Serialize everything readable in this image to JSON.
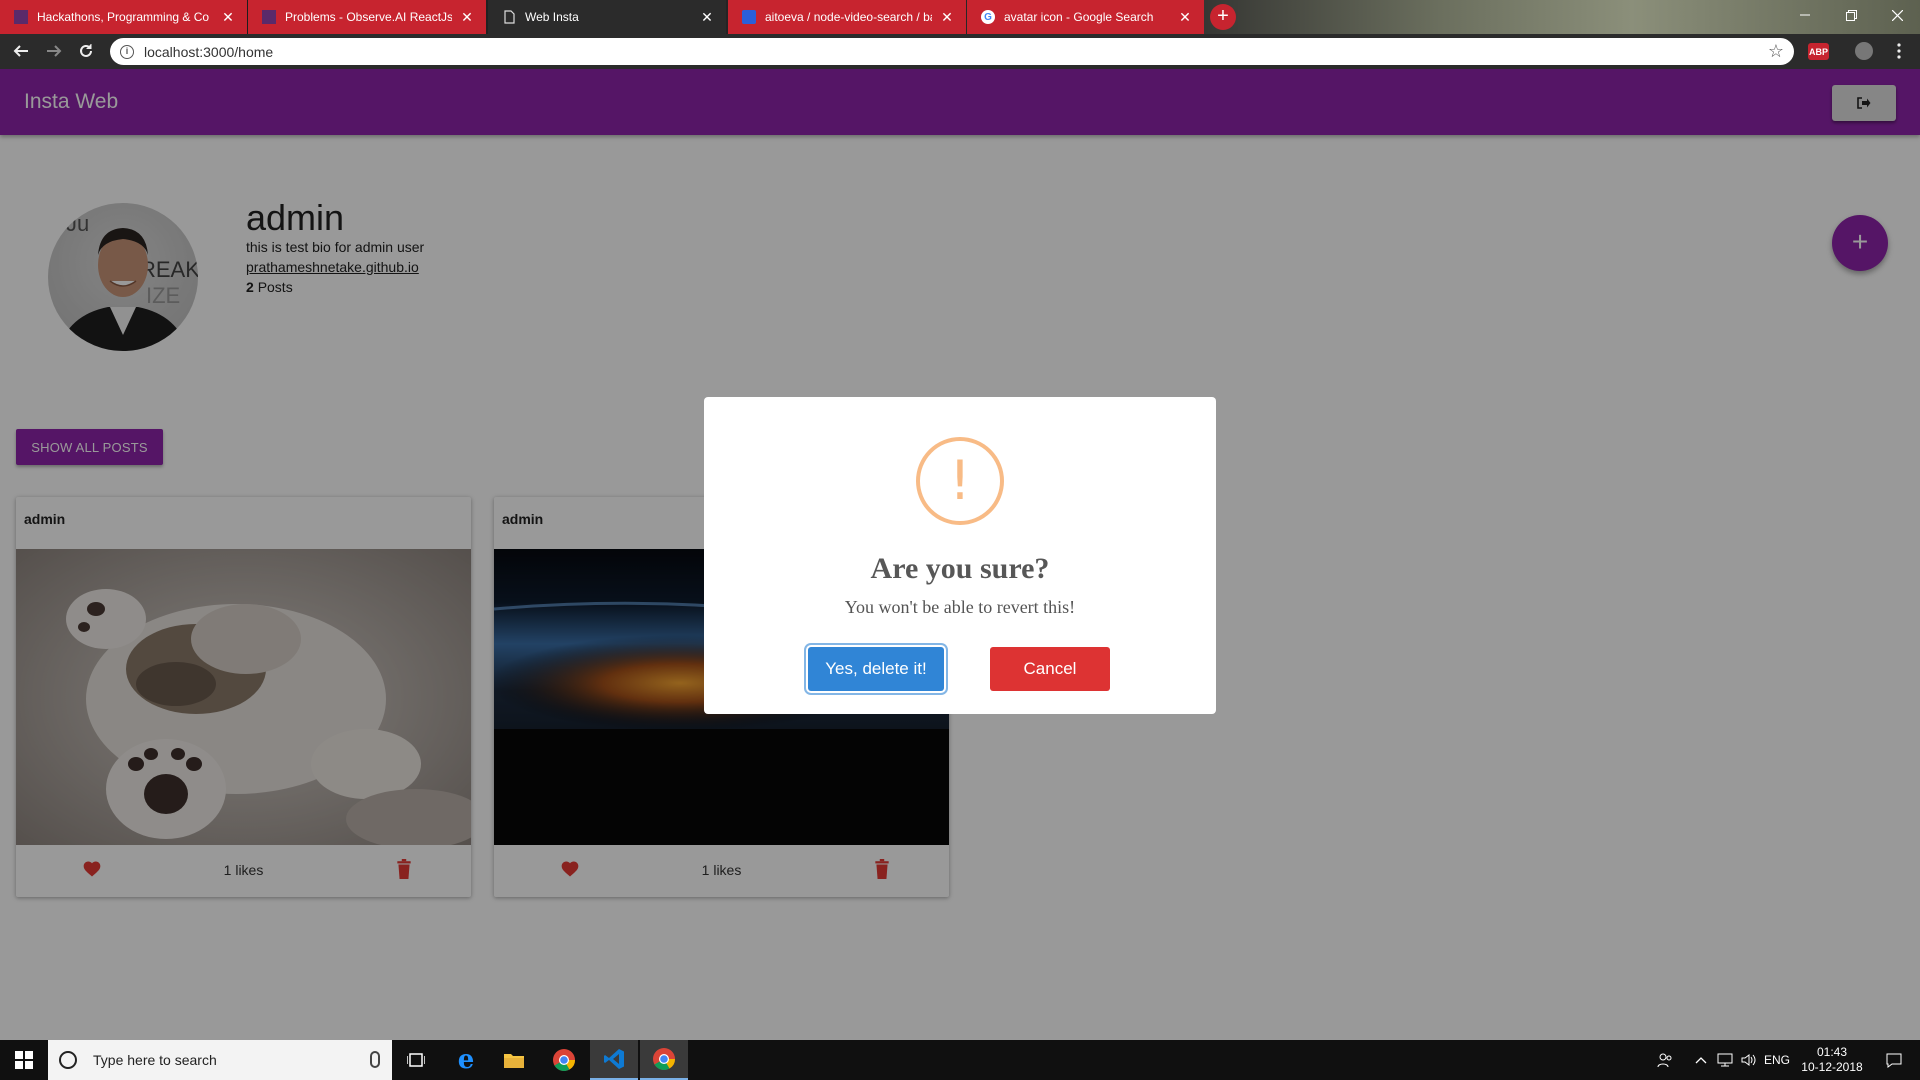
{
  "browser": {
    "tabs": [
      {
        "title": "Hackathons, Programming & Co",
        "icon": "hackerearth-icon"
      },
      {
        "title": "Problems - Observe.AI ReactJs H",
        "icon": "hackerearth-icon"
      },
      {
        "title": "Web Insta",
        "icon": "page-icon"
      },
      {
        "title": "aitoeva / node-video-search / ba",
        "icon": "bitbucket-icon"
      },
      {
        "title": "avatar icon - Google Search",
        "icon": "google-icon"
      }
    ],
    "url": "localhost:3000/home",
    "extension_label": "ABP"
  },
  "app": {
    "brand": "Insta Web",
    "profile": {
      "username": "admin",
      "bio": "this is test bio for admin user",
      "website": "prathameshnetake.github.io",
      "post_count": "2",
      "posts_label": "Posts"
    },
    "fab_label": "+",
    "show_all_label": "SHOW ALL POSTS",
    "posts": [
      {
        "owner": "admin",
        "likes": "1 likes",
        "image": "kitten-photo"
      },
      {
        "owner": "admin",
        "likes": "1 likes",
        "image": "earth-sunrise-photo"
      }
    ]
  },
  "dialog": {
    "icon": "!",
    "title": "Are you sure?",
    "text": "You won't be able to revert this!",
    "confirm_label": "Yes, delete it!",
    "cancel_label": "Cancel",
    "confirm_color": "#3085d6",
    "cancel_color": "#dd3333",
    "warning_color": "#f8bb86"
  },
  "taskbar": {
    "search_placeholder": "Type here to search",
    "language": "ENG",
    "time": "01:43",
    "date": "10-12-2018"
  },
  "colors": {
    "primary": "#8e24aa",
    "tab_accent": "#c7242f"
  }
}
